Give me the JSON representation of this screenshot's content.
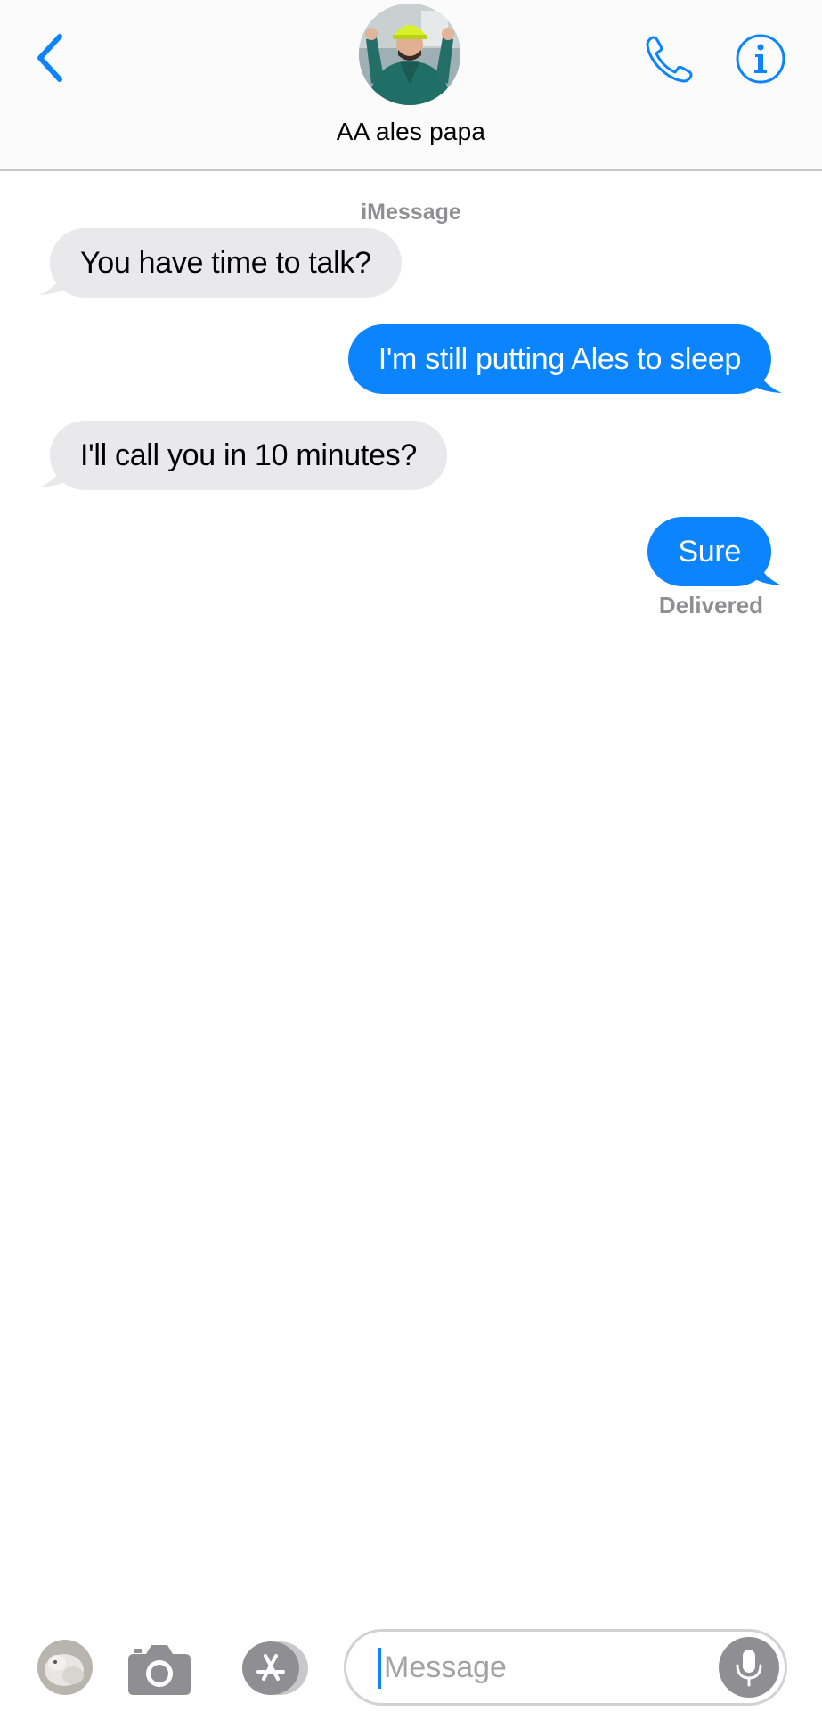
{
  "header": {
    "contact_name": "AA ales papa"
  },
  "conversation": {
    "service_label": "iMessage",
    "messages": [
      {
        "direction": "incoming",
        "text": "You have time to talk?"
      },
      {
        "direction": "outgoing",
        "text": "I'm still putting Ales to sleep"
      },
      {
        "direction": "incoming",
        "text": "I'll call you in 10 minutes?"
      },
      {
        "direction": "outgoing",
        "text": "Sure"
      }
    ],
    "status": "Delivered"
  },
  "composer": {
    "placeholder": "Message"
  },
  "colors": {
    "accent": "#0b84fe",
    "incoming_bubble": "#e9e9eb",
    "secondary_text": "#8e8e93"
  },
  "icons": {
    "back": "chevron-left-icon",
    "call": "phone-icon",
    "info": "info-icon",
    "camera": "camera-icon",
    "apps": "app-store-icon",
    "mic": "microphone-icon"
  }
}
